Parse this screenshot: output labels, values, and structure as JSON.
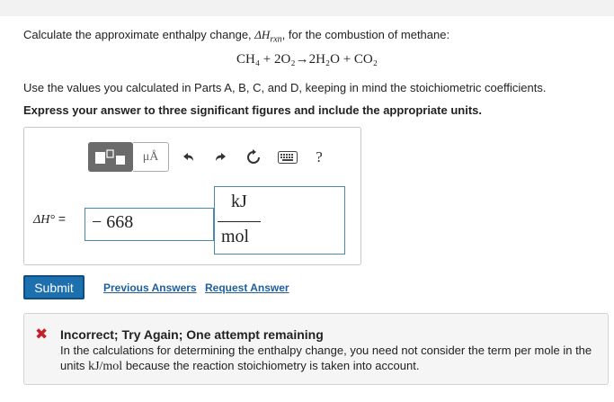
{
  "question": {
    "intro_before": "Calculate the approximate enthalpy change, ",
    "intro_symbol": "ΔH",
    "intro_sub": "rxn",
    "intro_after": ", for the combustion of methane:",
    "equation": "CH₄ + 2O₂→2H₂O + CO₂",
    "instructions": "Use the values you calculated in Parts A, B, C, and D, keeping in mind the stoichiometric coefficients.",
    "express": "Express your answer to three significant figures and include the appropriate units."
  },
  "toolbar": {
    "mu_label": "μÅ",
    "undo_icon": "undo-icon",
    "redo_icon": "redo-icon",
    "reset_icon": "reset-icon",
    "keyboard_icon": "keyboard-icon",
    "help_label": "?"
  },
  "answer": {
    "label_symbol": "ΔH°",
    "label_equals": " =",
    "value": "− 668",
    "unit_numerator": "kJ",
    "unit_denominator": "mol"
  },
  "actions": {
    "submit": "Submit",
    "previous_answers": "Previous Answers",
    "request_answer": "Request Answer"
  },
  "feedback": {
    "icon": "x-icon",
    "title": "Incorrect; Try Again; One attempt remaining",
    "text_before": "In the calculations for determining the enthalpy change, you need not consider the term per mole in the units ",
    "text_units": "kJ/mol",
    "text_after": " because the reaction stoichiometry is taken into account."
  },
  "colors": {
    "accent": "#1d6fae",
    "error": "#c8202b",
    "link": "#1f5e9c"
  }
}
